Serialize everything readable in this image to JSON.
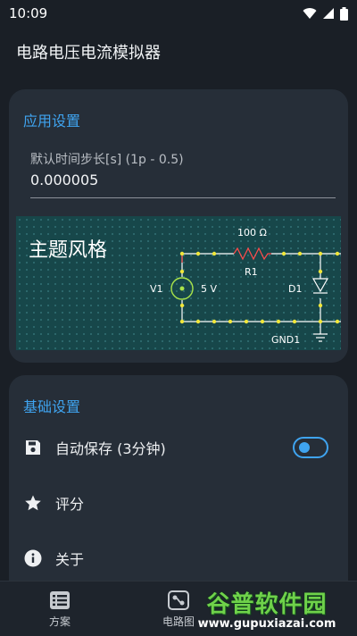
{
  "status_bar": {
    "time": "10:09"
  },
  "app_bar": {
    "title": "电路电压电流模拟器"
  },
  "app_settings": {
    "title": "应用设置",
    "timestep": {
      "label": "默认时间步长[s] (1p - 0.5)",
      "value": "0.000005"
    },
    "theme": {
      "title": "主题风格",
      "circuit": {
        "resistor_value": "100 Ω",
        "resistor_name": "R1",
        "source_name": "V1",
        "source_value": "5 V",
        "diode_name": "D1",
        "ground_name": "GND1"
      }
    }
  },
  "basic_settings": {
    "title": "基础设置",
    "autosave": {
      "label": "自动保存 (3分钟)",
      "enabled": true
    },
    "rate": {
      "label": "评分"
    },
    "about": {
      "label": "关于"
    }
  },
  "bottom_nav": {
    "items": [
      {
        "label": "方案",
        "icon": "list-icon"
      },
      {
        "label": "电路图",
        "icon": "circuit-icon"
      }
    ]
  },
  "watermark": {
    "title": "谷普软件园",
    "url": "www.gupuxiazai.com"
  },
  "colors": {
    "accent": "#3fa4f0",
    "card": "#262e38",
    "background": "#1a1f26",
    "theme_bg": "#17474a"
  }
}
